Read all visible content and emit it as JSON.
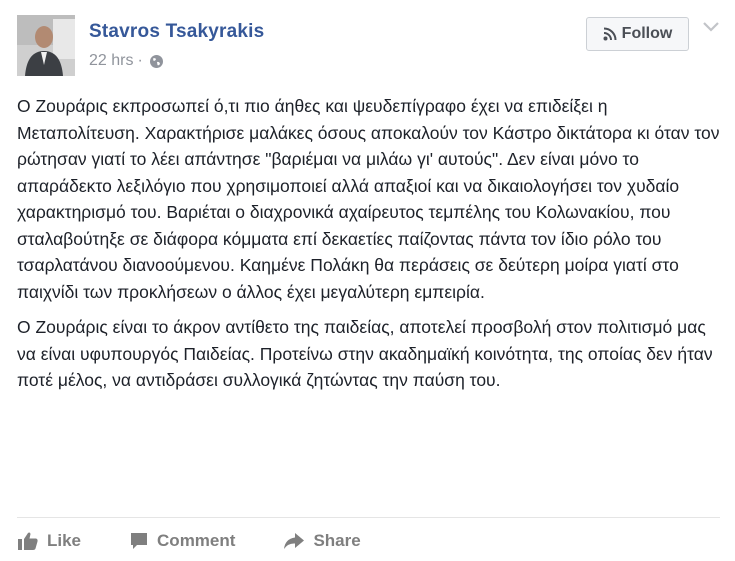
{
  "post": {
    "author": "Stavros Tsakyrakis",
    "time": "22 hrs",
    "separator": "·",
    "privacy_icon": "globe-icon",
    "follow_label": "Follow",
    "paragraphs": [
      "Ο Ζουράρις εκπροσωπεί ό,τι πιο άηθες και ψευδεπίγραφο έχει να επιδείξει η Μεταπολίτευση. Χαρακτήρισε μαλάκες όσους αποκαλούν τον Κάστρο δικτάτορα κι όταν τον ρώτησαν γιατί το λέει απάντησε \"βαριέμαι να μιλάω γι' αυτούς\". Δεν είναι μόνο το απαράδεκτο λεξιλόγιο που χρησιμοποιεί αλλά απαξιοί και να δικαιολογήσει τον χυδαίο χαρακτηρισμό του. Βαριέται ο διαχρονικά αχαίρευτος τεμπέλης του Κολωνακίου, που σταλαβούτηξε σε διάφορα κόμματα επί δεκαετίες παίζοντας πάντα τον ίδιο ρόλο του τσαρλατάνου διανοούμενου. Καημένε Πολάκη θα περάσεις σε δεύτερη μοίρα γιατί στο παιχνίδι των προκλήσεων ο άλλος έχει μεγαλύτερη εμπειρία.",
      "Ο Ζουράρις είναι το άκρον αντίθετο της παιδείας, αποτελεί προσβολή στον πολιτισμό μας να είναι υφυπουργός Παιδείας. Προτείνω στην ακαδημαϊκή κοινότητα, της οποίας δεν ήταν ποτέ μέλος, να αντιδράσει συλλογικά ζητώντας την παύση του."
    ]
  },
  "actions": {
    "like": "Like",
    "comment": "Comment",
    "share": "Share"
  },
  "colors": {
    "name_link": "#365899",
    "meta_text": "#90949c",
    "action_text": "#7f7f7f"
  }
}
